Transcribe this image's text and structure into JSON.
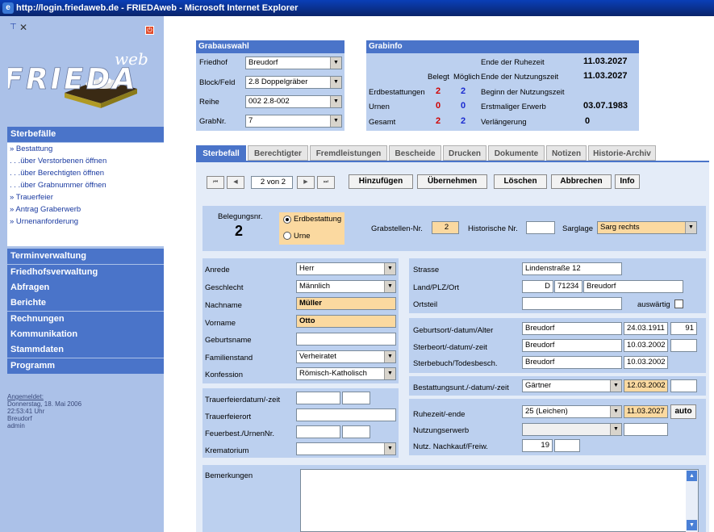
{
  "window_title": "http://login.friedaweb.de - FRIEDAweb - Microsoft Internet Explorer",
  "logo": {
    "text": "FRIEDA",
    "suffix": "web"
  },
  "sidebar": {
    "sterbefaelle": {
      "title": "Sterbefälle",
      "items": [
        "» Bestattung",
        ". . .über Verstorbenen öffnen",
        ". . .über Berechtigten öffnen",
        ". . .über Grabnummer öffnen",
        "» Trauerfeier",
        "» Antrag Graberwerb",
        "» Urnenanforderung"
      ]
    },
    "sections": [
      "Terminverwaltung",
      "Friedhofsverwaltung",
      "Abfragen",
      "Berichte",
      "Rechnungen",
      "Kommunikation",
      "Stammdaten",
      "Programm"
    ],
    "login": {
      "label": "Angemeldet:",
      "date": "Donnerstag, 18. Mai 2006",
      "time": "22:53:41 Uhr",
      "place": "Breudorf",
      "user": "admin"
    }
  },
  "grabauswahl": {
    "title": "Grabauswahl",
    "friedhof_label": "Friedhof",
    "friedhof": "Breudorf",
    "block_label": "Block/Feld",
    "block": "2.8 Doppelgräber",
    "reihe_label": "Reihe",
    "reihe": "002 2.8-002",
    "grabnr_label": "GrabNr.",
    "grabnr": "7"
  },
  "grabinfo": {
    "title": "Grabinfo",
    "ende_ruhezeit_label": "Ende der Ruhezeit",
    "ende_ruhezeit": "11.03.2027",
    "belegt_label": "Belegt",
    "moeglich_label": "Möglich",
    "ende_nutzung_label": "Ende der Nutzungszeit",
    "ende_nutzung": "11.03.2027",
    "erdbestattungen_label": "Erdbestattungen",
    "erd_belegt": "2",
    "erd_moeglich": "2",
    "beginn_nutzung_label": "Beginn der Nutzungszeit",
    "urnen_label": "Urnen",
    "urnen_belegt": "0",
    "urnen_moeglich": "0",
    "erwerb_label": "Erstmaliger Erwerb",
    "erwerb": "03.07.1983",
    "gesamt_label": "Gesamt",
    "gesamt_belegt": "2",
    "gesamt_moeglich": "2",
    "verlaengerung_label": "Verlängerung",
    "verlaengerung": "0"
  },
  "tabs": [
    "Sterbefall",
    "Berechtigter",
    "Fremdleistungen",
    "Bescheide",
    "Drucken",
    "Dokumente",
    "Notizen",
    "Historie-Archiv"
  ],
  "toolbar": {
    "first": "⏮",
    "prev": "◀",
    "record": "2 von 2",
    "next": "▶",
    "last": "⏭",
    "add": "Hinzufügen",
    "apply": "Übernehmen",
    "delete": "Löschen",
    "cancel": "Abbrechen",
    "info": "Info"
  },
  "belegung": {
    "nr_label": "Belegungsnr.",
    "nr": "2",
    "erd_label": "Erdbestattung",
    "urne_label": "Urne",
    "grabstellen_label": "Grabstellen-Nr.",
    "grabstellen": "2",
    "hist_label": "Historische Nr.",
    "hist": "",
    "sarglage_label": "Sarglage",
    "sarglage": "Sarg rechts"
  },
  "person": {
    "anrede_label": "Anrede",
    "anrede": "Herr",
    "geschlecht_label": "Geschlecht",
    "geschlecht": "Männlich",
    "nachname_label": "Nachname",
    "nachname": "Müller",
    "vorname_label": "Vorname",
    "vorname": "Otto",
    "geburtsname_label": "Geburtsname",
    "geburtsname": "",
    "familienstand_label": "Familienstand",
    "familienstand": "Verheiratet",
    "konfession_label": "Konfession",
    "konfession": "Römisch-Katholisch"
  },
  "address": {
    "strasse_label": "Strasse",
    "strasse": "Lindenstraße 12",
    "ort_label": "Land/PLZ/Ort",
    "land": "D",
    "plz": "71234",
    "ort": "Breudorf",
    "ortsteil_label": "Ortsteil",
    "ortsteil": "",
    "auswaertig_label": "auswärtig"
  },
  "trauerfeier": {
    "datum_label": "Trauerfeierdatum/-zeit",
    "ort_label": "Trauerfeierort",
    "feuerbest_label": "Feuerbest./UrnenNr.",
    "krematorium_label": "Krematorium"
  },
  "lebensdaten": {
    "geburt_label": "Geburtsort/-datum/Alter",
    "geburtsort": "Breudorf",
    "geburtsdatum": "24.03.1911",
    "alter": "91",
    "sterbe_label": "Sterbeort/-datum/-zeit",
    "sterbeort": "Breudorf",
    "sterbedatum": "10.03.2002",
    "sterbezeit": "",
    "sterbebuch_label": "Sterbebuch/Todesbesch.",
    "sterbebuch": "Breudorf",
    "todesbesch": "10.03.2002"
  },
  "bestattung": {
    "label": "Bestattungsunt./-datum/-zeit",
    "unternehmen": "Gärtner",
    "datum": "12.03.2002",
    "zeit": ""
  },
  "ruhezeit": {
    "label": "Ruhezeit/-ende",
    "ruhezeit": "25 (Leichen)",
    "ende": "11.03.2027",
    "auto": "auto",
    "nutzungserwerb_label": "Nutzungserwerb",
    "nachkauf_label": "Nutz. Nachkauf/Freiw.",
    "nachkauf": "19"
  },
  "bemerkungen_label": "Bemerkungen"
}
